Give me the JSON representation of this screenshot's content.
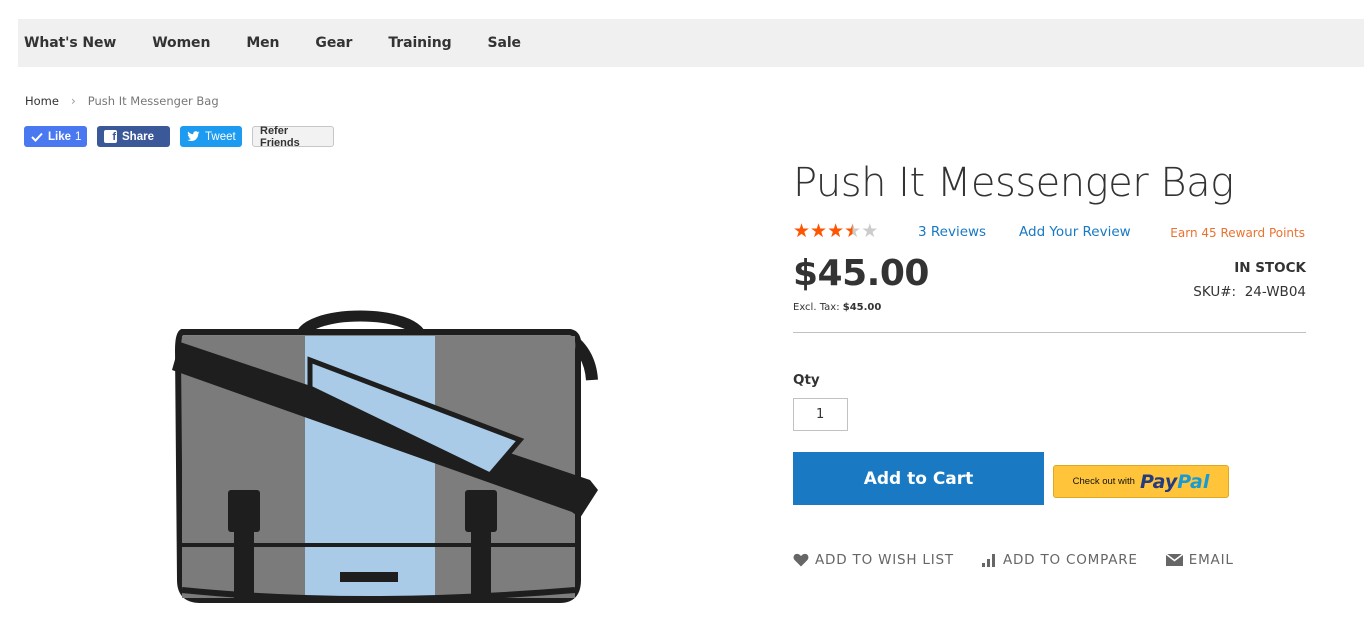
{
  "nav": {
    "items": [
      {
        "label": "What's New"
      },
      {
        "label": "Women"
      },
      {
        "label": "Men"
      },
      {
        "label": "Gear"
      },
      {
        "label": "Training"
      },
      {
        "label": "Sale"
      }
    ]
  },
  "breadcrumb": {
    "home": "Home",
    "separator": "›",
    "current": "Push It Messenger Bag"
  },
  "social": {
    "like_label": "Like",
    "like_count": "1",
    "share_label": "Share",
    "tweet_label": "Tweet",
    "refer_label": "Refer Friends"
  },
  "product": {
    "title": "Push It Messenger Bag",
    "rating": 3.5,
    "rating_max": 5,
    "reviews_link": "3 Reviews",
    "add_review_link": "Add Your Review",
    "reward_text": "Earn 45 Reward Points",
    "price": "$45.00",
    "excl_tax_label": "Excl. Tax:",
    "excl_tax_value": "$45.00",
    "stock_status": "IN STOCK",
    "sku_label": "SKU#:",
    "sku_value": "24-WB04",
    "qty_label": "Qty",
    "qty_value": "1",
    "add_to_cart_label": "Add to Cart",
    "paypal_prefix": "Check out with",
    "paypal_brand_a": "Pay",
    "paypal_brand_b": "Pal"
  },
  "actions": {
    "wishlist": "ADD TO WISH LIST",
    "compare": "ADD TO COMPARE",
    "email": "EMAIL"
  },
  "colors": {
    "accent": "#1979c3",
    "star": "#ff5501",
    "reward": "#ea7230",
    "paypal_bg": "#ffc439"
  }
}
